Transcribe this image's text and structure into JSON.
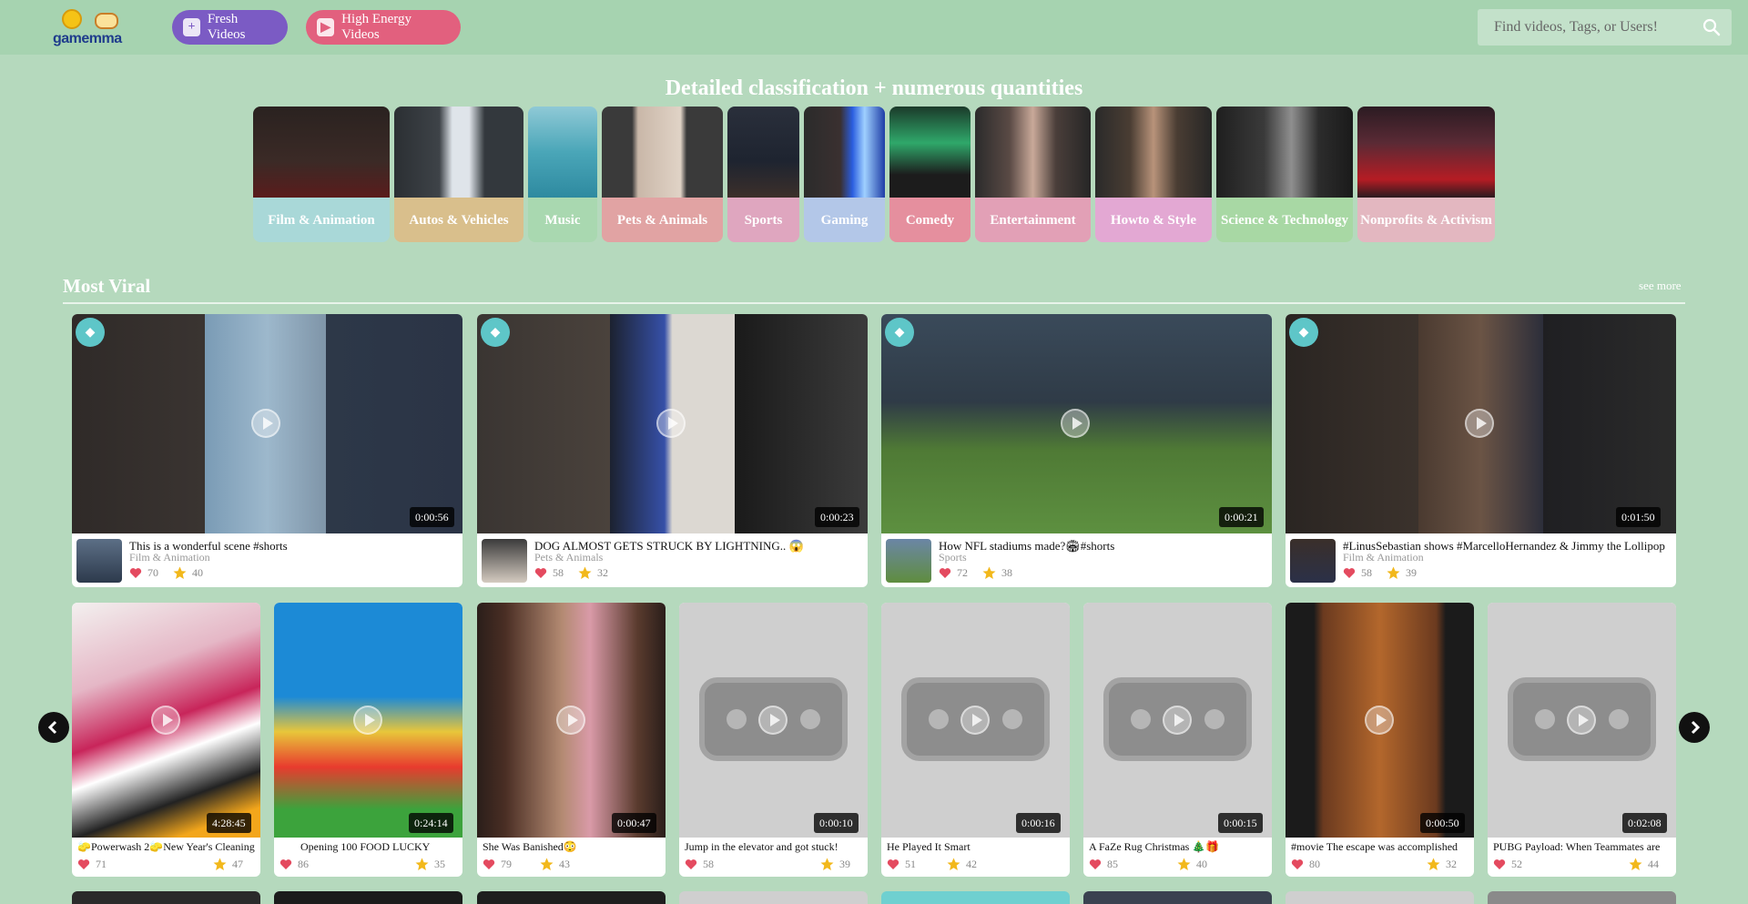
{
  "header": {
    "logo_text": "gamemma",
    "fresh_label": "Fresh Videos",
    "energy_label": "High Energy Videos",
    "search_placeholder": "Find videos, Tags, or Users!"
  },
  "classification": {
    "title": "Detailed classification + numerous quantities",
    "categories": [
      {
        "label": "Film & Animation",
        "color": "#a9d8d8"
      },
      {
        "label": "Autos & Vehicles",
        "color": "#d9bf8c"
      },
      {
        "label": "Music",
        "color": "#a9d8b0"
      },
      {
        "label": "Pets & Animals",
        "color": "#e1a3a3"
      },
      {
        "label": "Sports",
        "color": "#dfa6bf"
      },
      {
        "label": "Gaming",
        "color": "#b3c7e8"
      },
      {
        "label": "Comedy",
        "color": "#e58f9e"
      },
      {
        "label": "Entertainment",
        "color": "#e2a0b6"
      },
      {
        "label": "Howto & Style",
        "color": "#e3a8d3"
      },
      {
        "label": "Science & Technology",
        "color": "#a8d8a4"
      },
      {
        "label": "Nonprofits & Activism",
        "color": "#e3b7c0"
      }
    ]
  },
  "section": {
    "title": "Most Viral",
    "see_more": "see more"
  },
  "featured": [
    {
      "title": "This is a wonderful scene #shorts",
      "category": "Film & Animation",
      "likes": "70",
      "stars": "40",
      "duration": "0:00:56"
    },
    {
      "title": "DOG ALMOST GETS STRUCK BY LIGHTNING.. 😱",
      "category": "Pets & Animals",
      "likes": "58",
      "stars": "32",
      "duration": "0:00:23"
    },
    {
      "title": "How NFL stadiums made?🏟#shorts",
      "category": "Sports",
      "likes": "72",
      "stars": "38",
      "duration": "0:00:21"
    },
    {
      "title": "#LinusSebastian shows #MarcelloHernandez & Jimmy the Lollipop",
      "category": "Film & Animation",
      "likes": "58",
      "stars": "39",
      "duration": "0:01:50"
    }
  ],
  "videos": [
    {
      "title": "🧽Powerwash 2🧽New Year's Cleaning",
      "likes": "71",
      "stars": "47",
      "duration": "4:28:45"
    },
    {
      "title": "Opening 100 FOOD LUCKY",
      "likes": "86",
      "stars": "35",
      "duration": "0:24:14"
    },
    {
      "title": "She Was Banished😳",
      "likes": "79",
      "stars": "43",
      "duration": "0:00:47"
    },
    {
      "title": "Jump in the elevator and got stuck!",
      "likes": "58",
      "stars": "39",
      "duration": "0:00:10"
    },
    {
      "title": "He Played It Smart",
      "likes": "51",
      "stars": "42",
      "duration": "0:00:16"
    },
    {
      "title": "A FaZe Rug Christmas 🎄🎁",
      "likes": "85",
      "stars": "40",
      "duration": "0:00:15"
    },
    {
      "title": "#movie The escape was accomplished",
      "likes": "80",
      "stars": "32",
      "duration": "0:00:50"
    },
    {
      "title": "PUBG Payload: When Teammates are",
      "likes": "52",
      "stars": "44",
      "duration": "0:02:08"
    }
  ]
}
